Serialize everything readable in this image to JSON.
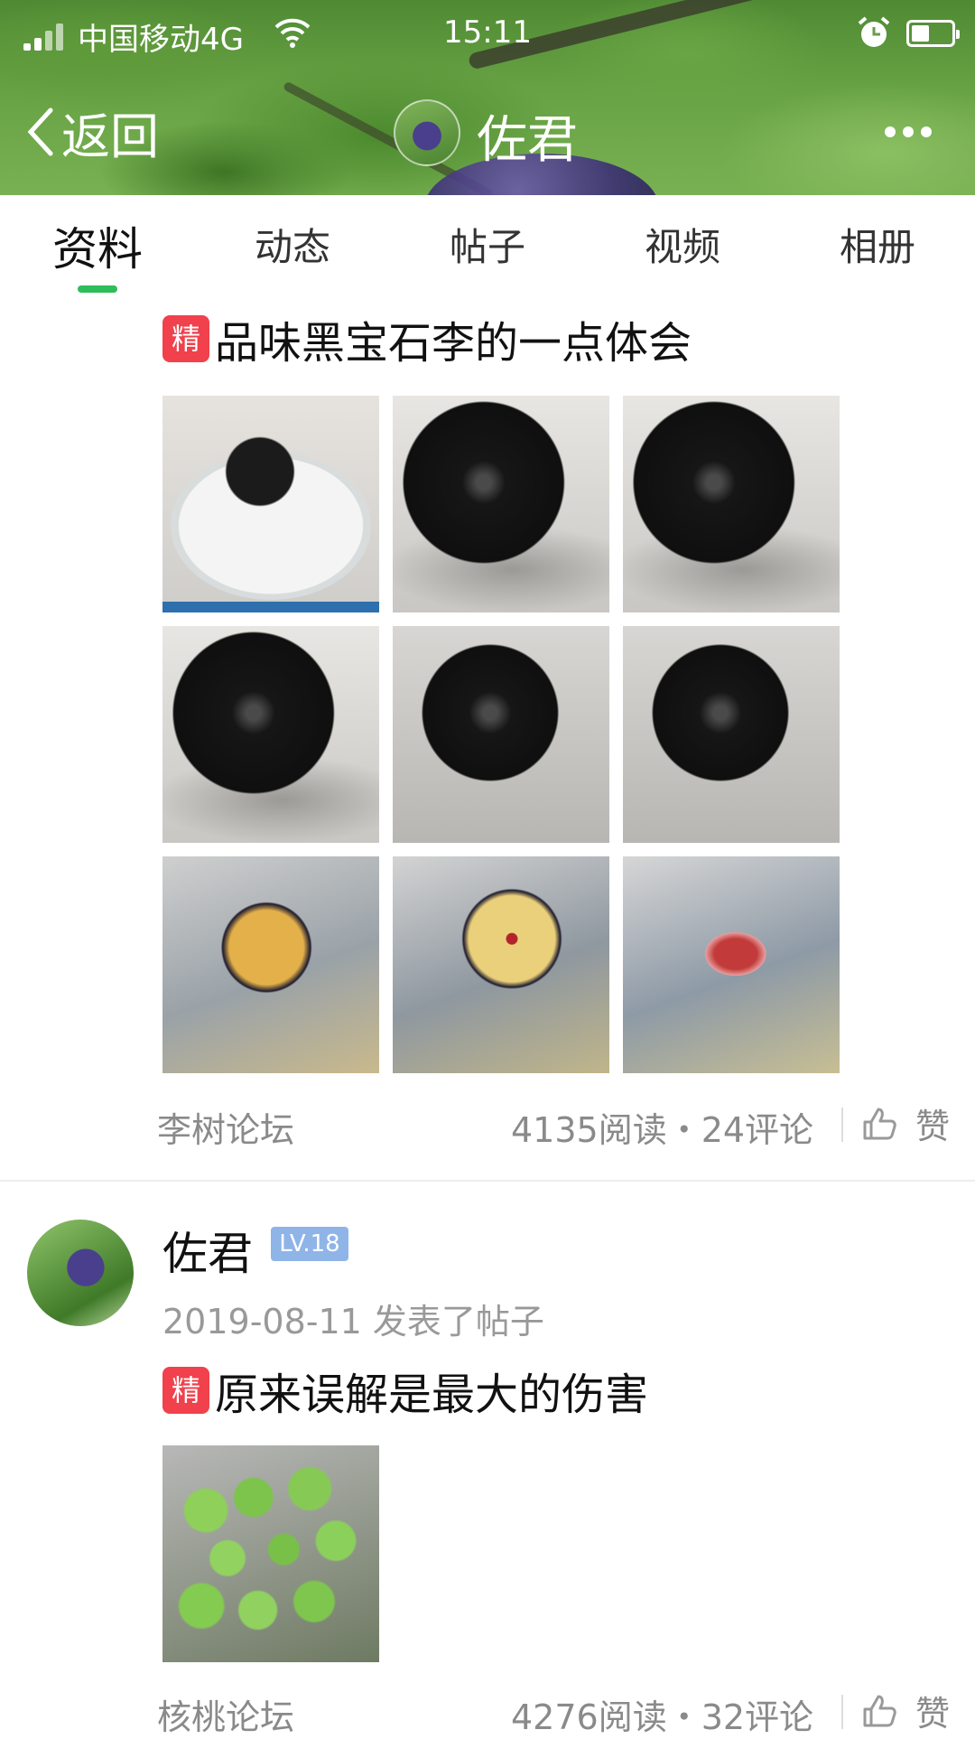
{
  "status_bar": {
    "carrier": "中国移动4G",
    "time": "15:11",
    "battery_level": 0.45
  },
  "nav": {
    "back_label": "返回",
    "title": "佐君"
  },
  "tabs": [
    {
      "label": "资料",
      "active": true
    },
    {
      "label": "动态",
      "active": false
    },
    {
      "label": "帖子",
      "active": false
    },
    {
      "label": "视频",
      "active": false
    },
    {
      "label": "相册",
      "active": false
    }
  ],
  "posts": [
    {
      "badge": "精",
      "title": "品味黑宝石李的一点体会",
      "forum": "李树论坛",
      "stats": "4135阅读・24评论",
      "like_label": "赞"
    },
    {
      "author": "佐君",
      "level": "LV.18",
      "meta": "2019-08-11 发表了帖子",
      "badge": "精",
      "title": "原来误解是最大的伤害",
      "forum": "核桃论坛",
      "stats": "4276阅读・32评论",
      "like_label": "赞"
    }
  ],
  "colors": {
    "accent": "#2ebd5a",
    "badge": "#f0414c",
    "level_badge": "#8fb4e8"
  }
}
